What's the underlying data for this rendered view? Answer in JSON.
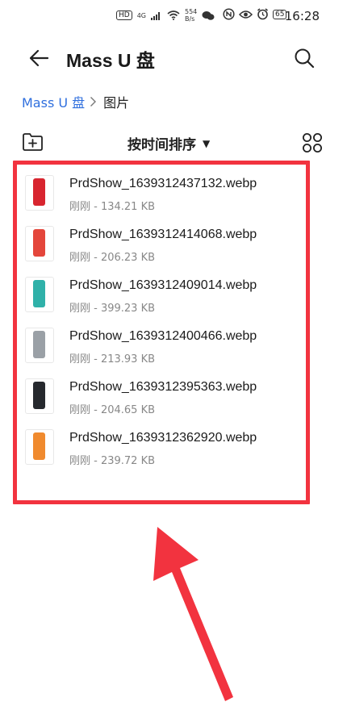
{
  "status_bar": {
    "hd_label": "HD",
    "network_label": "4G",
    "speed_value": "554",
    "speed_unit": "B/s",
    "battery_level": "65",
    "time": "16:28"
  },
  "header": {
    "title": "Mass U 盘"
  },
  "breadcrumb": {
    "root": "Mass U 盘",
    "current": "图片"
  },
  "toolbar": {
    "sort_label": "按时间排序"
  },
  "files": [
    {
      "name": "PrdShow_1639312437132.webp",
      "meta": "刚刚 - 134.21 KB",
      "thumb_color": "#d8252f"
    },
    {
      "name": "PrdShow_1639312414068.webp",
      "meta": "刚刚 - 206.23 KB",
      "thumb_color": "#e4463b"
    },
    {
      "name": "PrdShow_1639312409014.webp",
      "meta": "刚刚 - 399.23 KB",
      "thumb_color": "#2fb1a9"
    },
    {
      "name": "PrdShow_1639312400466.webp",
      "meta": "刚刚 - 213.93 KB",
      "thumb_color": "#9aa0a6"
    },
    {
      "name": "PrdShow_1639312395363.webp",
      "meta": "刚刚 - 204.65 KB",
      "thumb_color": "#26292e"
    },
    {
      "name": "PrdShow_1639312362920.webp",
      "meta": "刚刚 - 239.72 KB",
      "thumb_color": "#f08a2e"
    }
  ],
  "annotation_color": "#f2333f"
}
